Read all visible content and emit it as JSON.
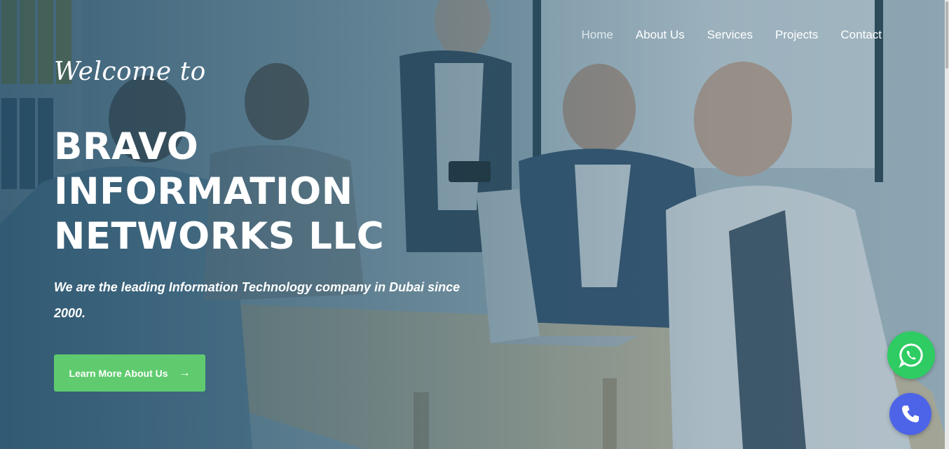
{
  "nav": {
    "items": [
      {
        "label": "Home",
        "active": true
      },
      {
        "label": "About Us"
      },
      {
        "label": "Services"
      },
      {
        "label": "Projects"
      },
      {
        "label": "Contact"
      }
    ]
  },
  "hero": {
    "welcome": "Welcome to",
    "title_lines": [
      "BRAVO",
      "INFORMATION",
      "NETWORKS LLC"
    ],
    "tagline": "We are the leading Information Technology company in Dubai since 2000.",
    "cta_label": "Learn More About Us",
    "cta_arrow": "→"
  },
  "floating": {
    "whatsapp_icon": "whatsapp-icon",
    "phone_icon": "phone-icon"
  },
  "colors": {
    "cta": "#5fcb6e",
    "whatsapp": "#2ecc63",
    "phone": "#4d64e8",
    "overlay": "#184460"
  }
}
